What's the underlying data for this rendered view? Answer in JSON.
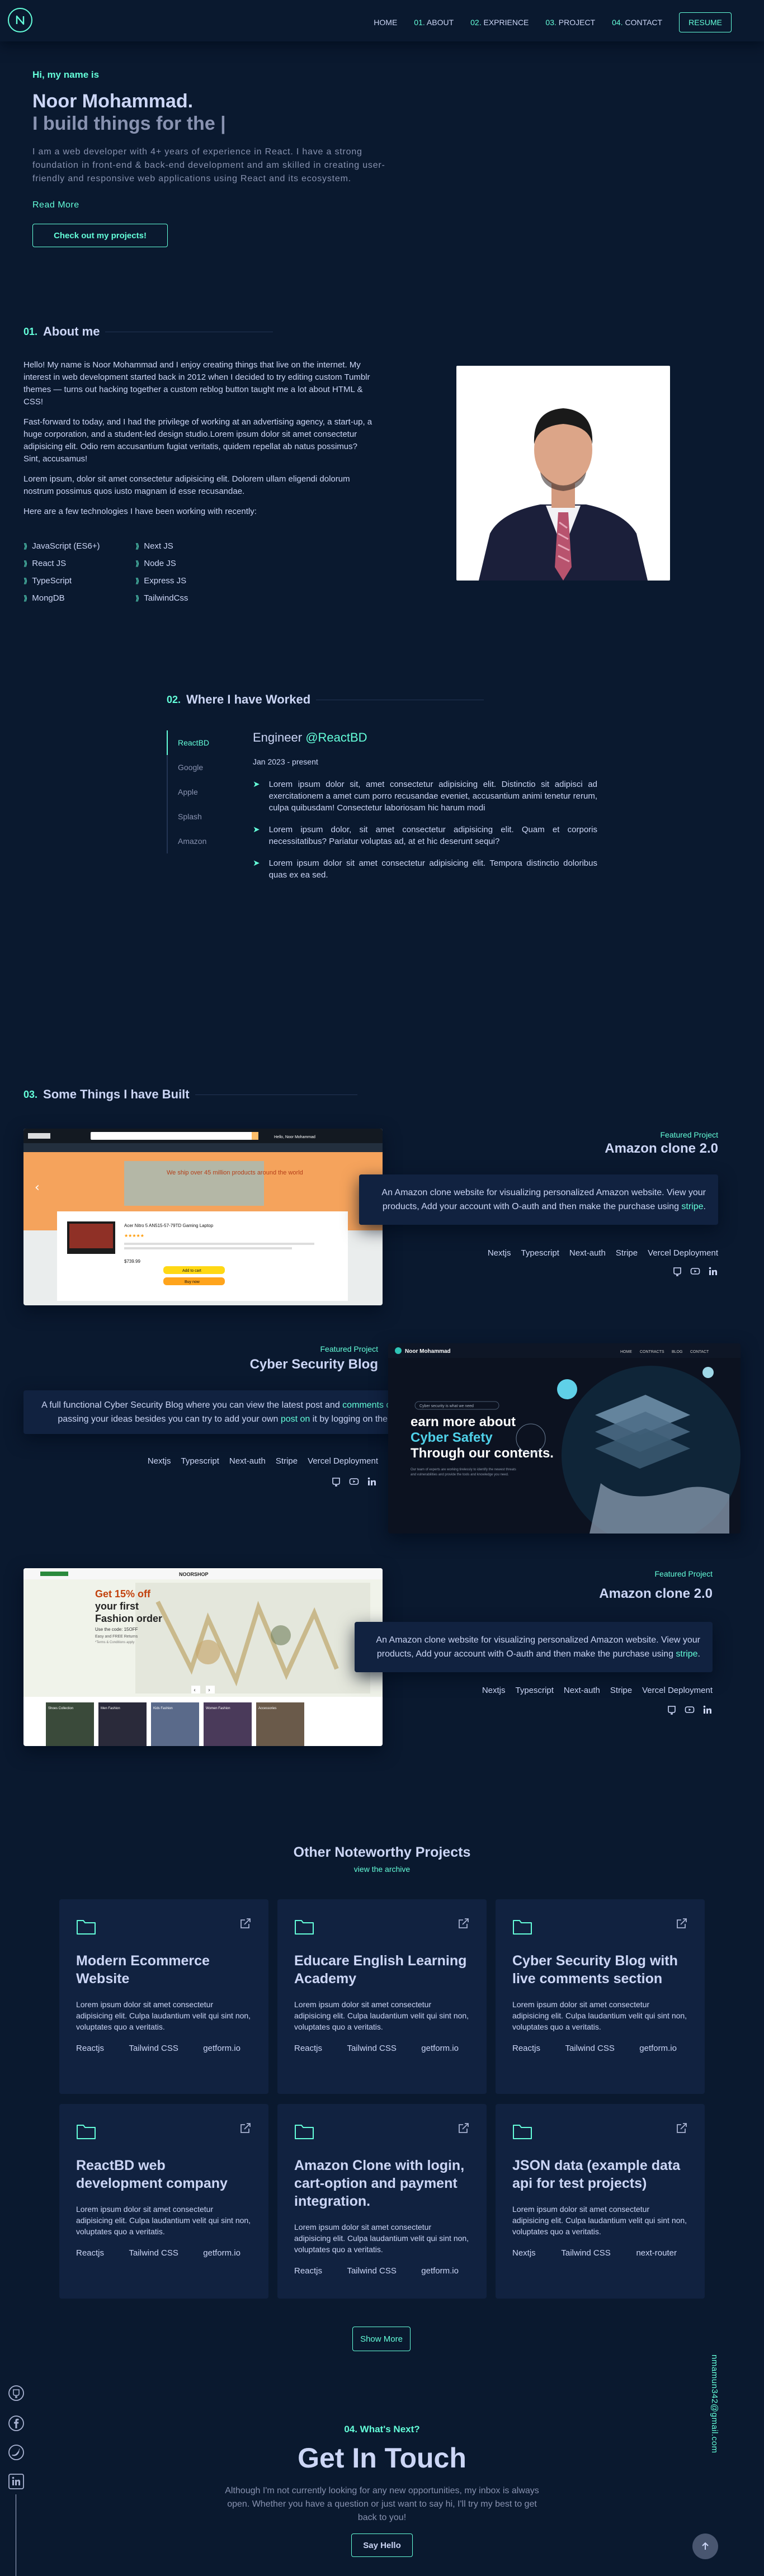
{
  "nav": {
    "links": [
      {
        "num": "",
        "label": "HOME"
      },
      {
        "num": "01.",
        "label": "ABOUT"
      },
      {
        "num": "02.",
        "label": "EXPRIENCE"
      },
      {
        "num": "03.",
        "label": "PROJECT"
      },
      {
        "num": "04.",
        "label": "CONTACT"
      }
    ],
    "resume": "RESUME"
  },
  "hero": {
    "greeting": "Hi, my name is",
    "name": "Noor Mohammad.",
    "tagline": "I build things for the |",
    "description": "I am a web developer with 4+ years of experience in React. I have a strong foundation in front-end & back-end development and am skilled in creating user-friendly and responsive web applications using React and its ecosystem.",
    "read_more": "Read More",
    "cta": "Check out my projects!"
  },
  "about": {
    "num": "01.",
    "title": "About me",
    "paragraphs": [
      "Hello! My name is Noor Mohammad and I enjoy creating things that live on the internet. My interest in web development started back in 2012 when I decided to try editing custom Tumblr themes — turns out hacking together a custom reblog button taught me a lot about HTML & CSS!",
      "Fast-forward to today, and I had the privilege of working at an advertising agency, a start-up, a huge corporation, and a student-led design studio.Lorem ipsum dolor sit amet consectetur adipisicing elit. Odio rem accusantium fugiat veritatis, quidem repellat ab natus possimus? Sint, accusamus!",
      "Lorem ipsum, dolor sit amet consectetur adipisicing elit. Dolorem ullam eligendi dolorum nostrum possimus quos iusto magnam id esse recusandae.",
      "Here are a few technologies I have been working with recently:"
    ],
    "technologies": [
      "JavaScript (ES6+)",
      "Next JS",
      "React JS",
      "Node JS",
      "TypeScript",
      "Express JS",
      "MongDB",
      "TailwindCss"
    ]
  },
  "experience": {
    "num": "02.",
    "title": "Where I have Worked",
    "tabs": [
      "ReactBD",
      "Google",
      "Apple",
      "Splash",
      "Amazon"
    ],
    "role": "Engineer",
    "company": "@ReactBD",
    "date": "Jan 2023 - present",
    "bullets": [
      "Lorem ipsum dolor sit, amet consectetur adipisicing elit. Distinctio sit adipisci ad exercitationem a amet cum porro recusandae eveniet, accusantium animi tenetur rerum, culpa quibusdam! Consectetur laboriosam hic harum modi",
      "Lorem ipsum dolor, sit amet consectetur adipisicing elit. Quam et corporis necessitatibus? Pariatur voluptas ad, at et hic deserunt sequi?",
      "Lorem ipsum dolor sit amet consectetur adipisicing elit. Tempora distinctio doloribus quas ex ea sed."
    ]
  },
  "projects": {
    "num": "03.",
    "title": "Some Things I have Built",
    "items": [
      {
        "label": "Featured Project",
        "title": "Amazon clone 2.0",
        "desc_a": "An Amazon clone website for visualizing personalized Amazon website. View your products, Add your account with O-auth and then make the purchase using ",
        "desc_link": "stripe",
        "desc_b": ".",
        "tech": [
          "Nextjs",
          "Typescript",
          "Next-auth",
          "Stripe",
          "Vercel Deployment"
        ]
      },
      {
        "label": "Featured Project",
        "title": "Cyber Security Blog",
        "desc_a": "A full functional Cyber Security Blog where you can view the latest post and ",
        "desc_link": "comments on it",
        "desc_mid": " by passing your ideas besides you can try to add your own ",
        "desc_link2": "post on",
        "desc_b": " it by logging on the portal.",
        "tech": [
          "Nextjs",
          "Typescript",
          "Next-auth",
          "Stripe",
          "Vercel Deployment"
        ]
      },
      {
        "label": "Featured Project",
        "title": "Amazon clone 2.0",
        "desc_a": "An Amazon clone website for visualizing personalized Amazon website. View your products, Add your account with O-auth and then make the purchase using ",
        "desc_link": "stripe",
        "desc_b": ".",
        "tech": [
          "Nextjs",
          "Typescript",
          "Next-auth",
          "Stripe",
          "Vercel Deployment"
        ]
      }
    ],
    "shots": {
      "amazon1": {
        "banner": "We ship over 45 million products around the world",
        "product": "Acer Nitro 5 AN515-57-79TD Gaming Laptop",
        "price": "$739.99",
        "account": "Hello, Noor Mohammad",
        "cart_btn": "Add to cart",
        "buy_btn": "Buy now"
      },
      "cyber": {
        "brand": "Noor Mohammad",
        "menu": [
          "HOME",
          "CONTRACTS",
          "BLOG",
          "CONTACT"
        ],
        "pill": "Cyber security is what we need",
        "line1": "earn more about",
        "line2": "Cyber Safety",
        "line3": "Through our contents.",
        "body": "Our team of experts are working tirelessly to identify the newest threats and vulnerabilities and provide the tools and knowledge you need."
      },
      "shop": {
        "brand": "NOORSHOP",
        "line1": "Get 15% off",
        "line2": "your first",
        "line3": "Fashion order",
        "line4": "Use the code: 15OFF",
        "line5": "Easy and FREE Returns",
        "line6": "*Terms & Conditions apply",
        "thumbs": [
          "Shoes Collection",
          "Men Fashion",
          "Kids Fashion",
          "Women Fashion",
          "Accessories"
        ]
      }
    }
  },
  "other": {
    "title": "Other Noteworthy Projects",
    "link": "view the archive",
    "cards": [
      {
        "title": "Modern Ecommerce Website",
        "desc": "Lorem ipsum dolor sit amet consectetur adipisicing elit. Culpa laudantium velit qui sint non, voluptates quo a veritatis.",
        "tech": [
          "Reactjs",
          "Tailwind CSS",
          "getform.io"
        ]
      },
      {
        "title": "Educare English Learning Academy",
        "desc": "Lorem ipsum dolor sit amet consectetur adipisicing elit. Culpa laudantium velit qui sint non, voluptates quo a veritatis.",
        "tech": [
          "Reactjs",
          "Tailwind CSS",
          "getform.io"
        ]
      },
      {
        "title": "Cyber Security Blog with live comments section",
        "desc": "Lorem ipsum dolor sit amet consectetur adipisicing elit. Culpa laudantium velit qui sint non, voluptates quo a veritatis.",
        "tech": [
          "Reactjs",
          "Tailwind CSS",
          "getform.io"
        ]
      },
      {
        "title": "ReactBD web development company",
        "desc": "Lorem ipsum dolor sit amet consectetur adipisicing elit. Culpa laudantium velit qui sint non, voluptates quo a veritatis.",
        "tech": [
          "Reactjs",
          "Tailwind CSS",
          "getform.io"
        ]
      },
      {
        "title": "Amazon Clone with login, cart-option and payment integration.",
        "desc": "Lorem ipsum dolor sit amet consectetur adipisicing elit. Culpa laudantium velit qui sint non, voluptates quo a veritatis.",
        "tech": [
          "Reactjs",
          "Tailwind CSS",
          "getform.io"
        ]
      },
      {
        "title": "JSON data (example data api for test projects)",
        "desc": "Lorem ipsum dolor sit amet consectetur adipisicing elit. Culpa laudantium velit qui sint non, voluptates quo a veritatis.",
        "tech": [
          "Nextjs",
          "Tailwind CSS",
          "next-router"
        ]
      }
    ],
    "show_more": "Show More"
  },
  "contact": {
    "num": "04. What's Next?",
    "title": "Get In Touch",
    "text": "Although I'm not currently looking for any new opportunities, my inbox is always open. Whether you have a question or just want to say hi, I'll try my best to get back to you!",
    "button": "Say Hello",
    "email": "nmamun342@gmail.com"
  },
  "socials": [
    "github-icon",
    "facebook-icon",
    "twitter-icon",
    "linkedin-icon"
  ],
  "colors": {
    "background": "#0a192f",
    "card": "#112240",
    "accent": "#64ffda",
    "text": "#ccd6f6",
    "muted": "#8892b0"
  }
}
